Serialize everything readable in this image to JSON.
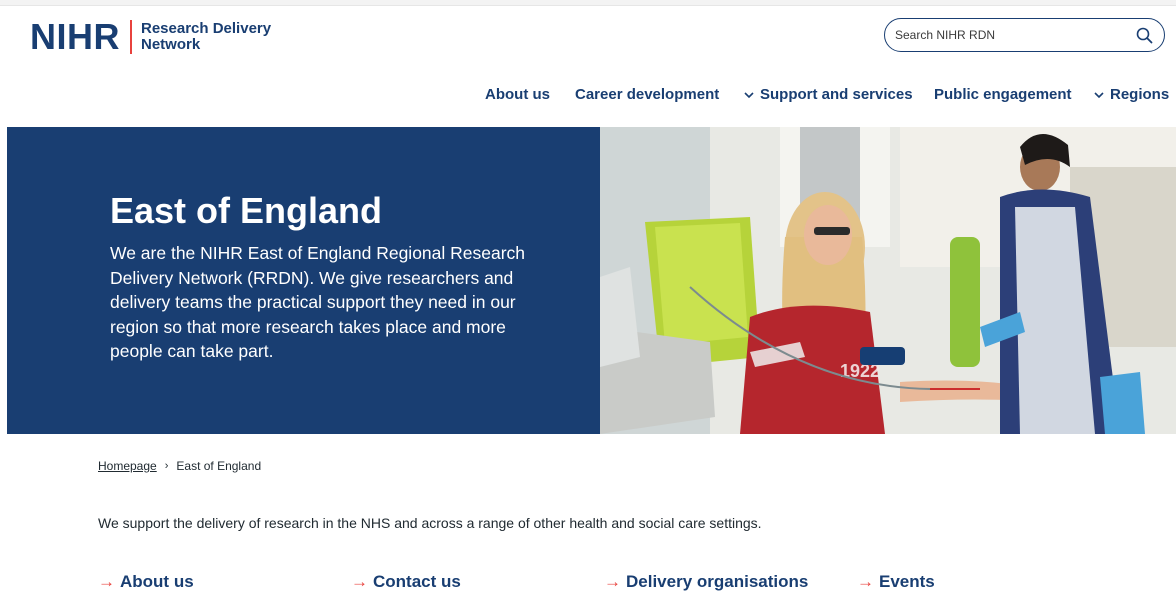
{
  "header": {
    "logo_mark": "NIHR",
    "logo_line1": "Research Delivery",
    "logo_line2": "Network",
    "search_placeholder": "Search NIHR RDN",
    "search_icon": "search-icon"
  },
  "nav": {
    "items": [
      {
        "label": "About us",
        "has_dropdown": false
      },
      {
        "label": "Career development",
        "has_dropdown": false
      },
      {
        "label": "Support and services",
        "has_dropdown": true
      },
      {
        "label": "Public engagement",
        "has_dropdown": false
      },
      {
        "label": "Regions",
        "has_dropdown": true
      }
    ]
  },
  "hero": {
    "title": "East of England",
    "description": "We are the NIHR East of England Regional Research Delivery Network (RRDN). We give researchers and delivery teams the practical support they need in our region so that more research takes place and more people can take part."
  },
  "breadcrumb": {
    "home": "Homepage",
    "current": "East of England"
  },
  "intro": "We support the delivery of research in the NHS and across a range of other health and social care settings.",
  "quick_links": [
    {
      "label": "About us"
    },
    {
      "label": "Contact us"
    },
    {
      "label": "Delivery organisations"
    },
    {
      "label": "Events"
    }
  ],
  "colors": {
    "brand_navy": "#193e72",
    "accent_red": "#e8423d",
    "text": "#212b32"
  }
}
